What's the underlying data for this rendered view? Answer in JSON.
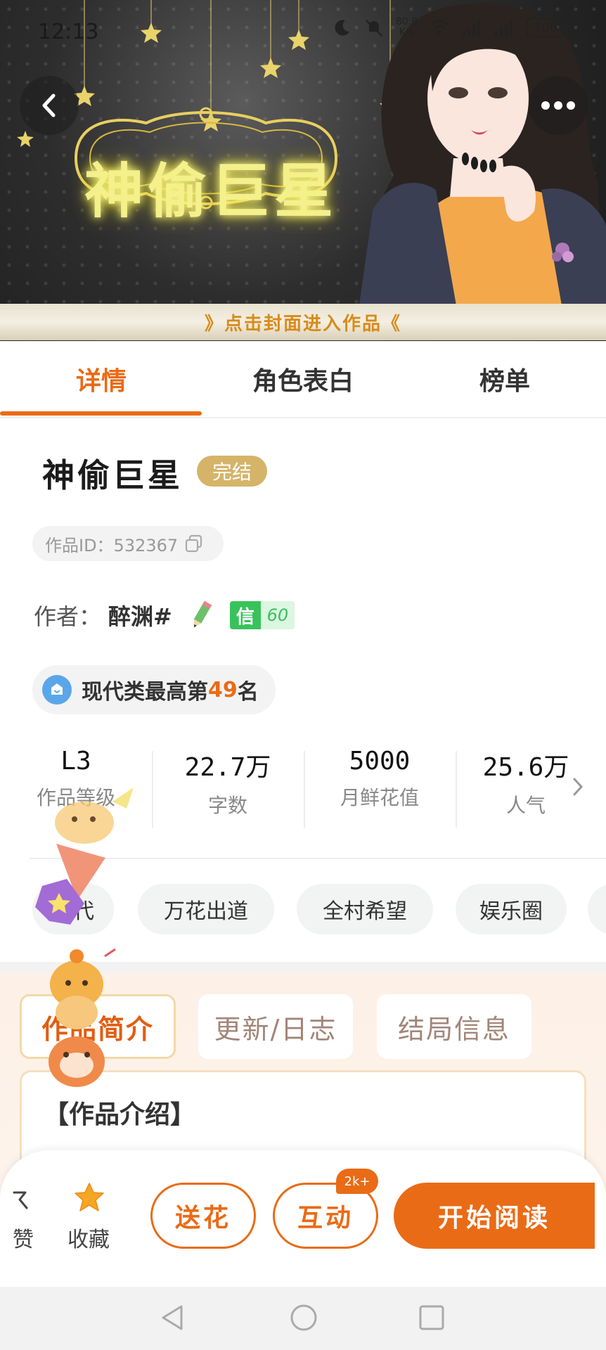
{
  "status_bar": {
    "time": "12:13",
    "net_speed_value": "80.8",
    "net_speed_unit": "K/s",
    "battery": "100"
  },
  "cover": {
    "title": "神偷巨星",
    "banner_text": "》点击封面进入作品《"
  },
  "tabs": [
    {
      "label": "详情",
      "active": true
    },
    {
      "label": "角色表白",
      "active": false
    },
    {
      "label": "榜单",
      "active": false
    }
  ],
  "book": {
    "title": "神偷巨星",
    "status": "完结",
    "id_label": "作品ID：532367",
    "author_label": "作者：",
    "author_name": "醉渊#",
    "trust_label": "信",
    "trust_value": "60",
    "rank_prefix": "现代类最高第",
    "rank_number": "49",
    "rank_suffix": "名"
  },
  "stats": [
    {
      "value": "L3",
      "label": "作品等级"
    },
    {
      "value": "22.7万",
      "label": "字数"
    },
    {
      "value": "5000",
      "label": "月鲜花值"
    },
    {
      "value": "25.6万",
      "label": "人气"
    }
  ],
  "tags": [
    "现代",
    "万花出道",
    "全村希望",
    "娱乐圈"
  ],
  "intro": {
    "tabs": [
      {
        "label": "作品简介",
        "active": true
      },
      {
        "label": "更新/日志",
        "active": false
      },
      {
        "label": "结局信息",
        "active": false
      }
    ],
    "heading": "【作品介绍】"
  },
  "actions": {
    "like_label": "赞",
    "fav_label": "收藏",
    "flower_label": "送花",
    "interact_label": "互动",
    "interact_badge": "2k+",
    "read_label": "开始阅读"
  },
  "colors": {
    "accent": "#ea6b16",
    "status_badge": "#d5b46a",
    "trust_green": "#39c25b",
    "rank_icon": "#5aa6ea"
  },
  "icons": [
    "back-arrow-icon",
    "more-dots-icon",
    "copy-icon",
    "pencil-icon",
    "rank-badge-icon",
    "chevron-right-icon",
    "like-icon",
    "star-icon",
    "nav-back-icon",
    "nav-home-icon",
    "nav-recent-icon"
  ]
}
